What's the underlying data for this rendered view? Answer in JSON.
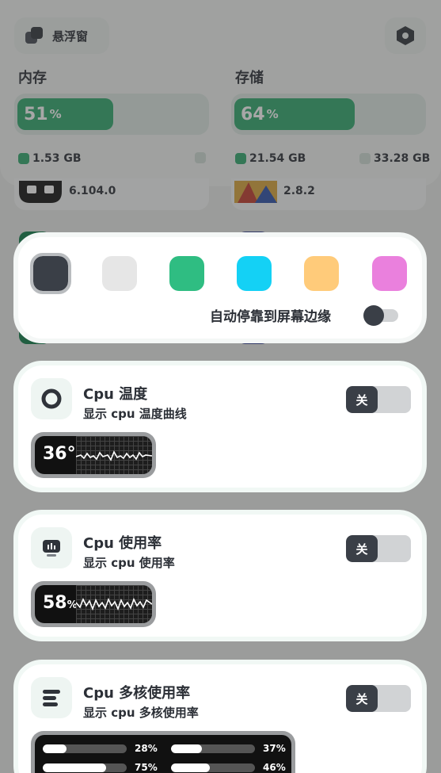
{
  "header": {
    "float_label": "悬浮窗",
    "memory": {
      "title": "内存",
      "percent": "51",
      "unit": "%",
      "used": "1.53 GB",
      "fill": 0.51
    },
    "storage": {
      "title": "存储",
      "percent": "64",
      "unit": "%",
      "used": "21.54 GB",
      "total": "33.28 GB",
      "fill": 0.64
    }
  },
  "peek_apps": [
    {
      "version": "6.104.0"
    },
    {
      "version": "2.8.2"
    }
  ],
  "colors": {
    "accent": "#2fa86c",
    "swatches": [
      "#3a3f47",
      "#e6e6e6",
      "#2fbd82",
      "#14d1f5",
      "#ffcb7a",
      "#ea80dd"
    ]
  },
  "dock": {
    "label": "自动停靠到屏幕边缘",
    "enabled": false
  },
  "features": [
    {
      "name": "Cpu 温度",
      "desc": "显示 cpu 温度曲线",
      "toggle_label": "关",
      "widget_value": "36°",
      "widget_unit": ""
    },
    {
      "name": "Cpu 使用率",
      "desc": "显示 cpu 使用率",
      "toggle_label": "关",
      "widget_value": "58",
      "widget_unit": "%"
    },
    {
      "name": "Cpu 多核使用率",
      "desc": "显示 cpu 多核使用率",
      "toggle_label": "关",
      "cores": [
        {
          "label": "28%",
          "value": 0.28
        },
        {
          "label": "37%",
          "value": 0.37
        },
        {
          "label": "75%",
          "value": 0.75
        },
        {
          "label": "46%",
          "value": 0.46
        }
      ]
    }
  ]
}
